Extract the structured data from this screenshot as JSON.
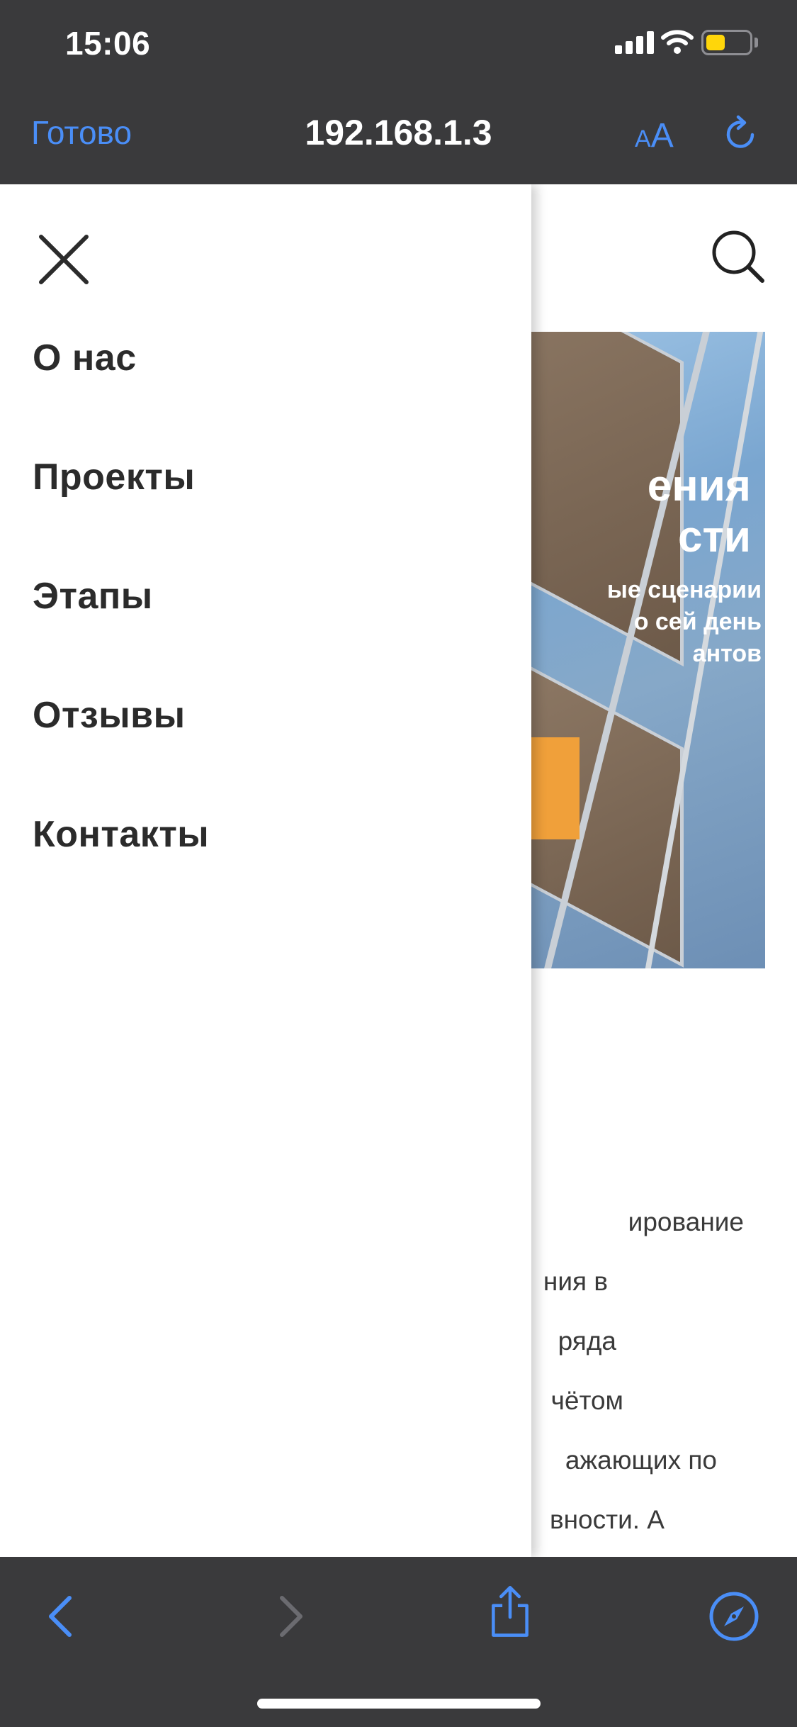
{
  "status_bar": {
    "time": "15:06",
    "icons": [
      "cellular-signal-icon",
      "wifi-icon",
      "battery-icon"
    ],
    "battery_color": "#ffd60a"
  },
  "browser": {
    "done_label": "Готово",
    "url": "192.168.1.3",
    "text_size_small": "A",
    "text_size_big": "A",
    "accent_color": "#4a8ef7"
  },
  "drawer": {
    "menu_items": [
      "О нас",
      "Проекты",
      "Этапы",
      "Отзывы",
      "Контакты"
    ]
  },
  "hero": {
    "title_lines": [
      "ения",
      "сти"
    ],
    "subtitle_lines": [
      "ые сценарии",
      "о сей день",
      "антов"
    ],
    "cta_color": "#f0a03a"
  },
  "body_text": {
    "lines": [
      "ирование",
      "ния в",
      "ряда",
      "чётом",
      "ажающих по",
      "вности. А"
    ]
  },
  "toolbar": {
    "icons": [
      "back-icon",
      "forward-icon",
      "share-icon",
      "compass-icon"
    ]
  }
}
